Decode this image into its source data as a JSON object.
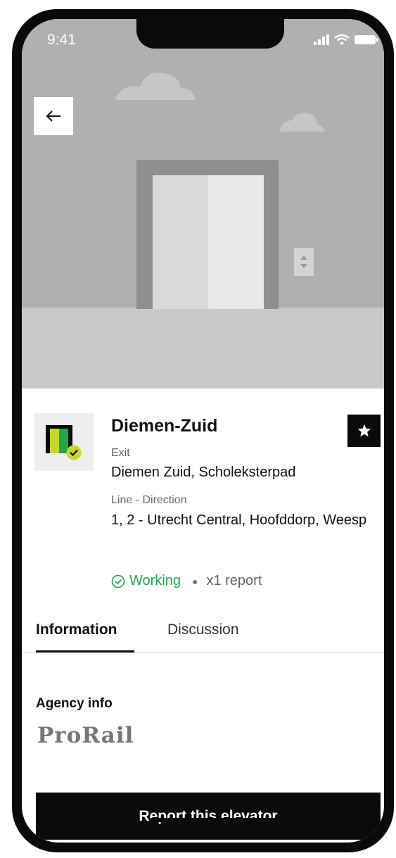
{
  "status_bar": {
    "time": "9:41"
  },
  "station": {
    "name": "Diemen-Zuid",
    "exit_label": "Exit",
    "exit_value": "Diemen Zuid, Scholeksterpad",
    "line_label": "Line - Direction",
    "line_value": "1, 2 - Utrecht Central, Hoofddorp, Weesp",
    "status": "Working",
    "reports": "x1 report"
  },
  "tabs": [
    {
      "label": "Information",
      "active": true
    },
    {
      "label": "Discussion",
      "active": false
    }
  ],
  "agency": {
    "section_title": "Agency info",
    "logo_text": "ProRail"
  },
  "actions": {
    "report_button": "Report this elevator"
  },
  "colors": {
    "accent_black": "#0a0a0a",
    "status_green": "#1fa54a",
    "icon_lime": "#c5d82a",
    "icon_green": "#1fa54a"
  }
}
